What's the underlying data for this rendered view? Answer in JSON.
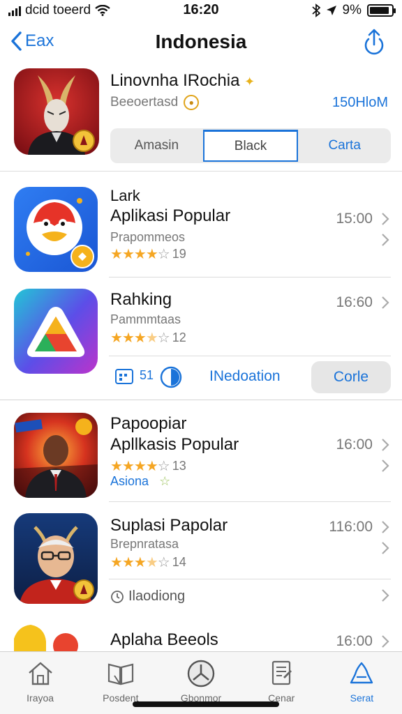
{
  "status_bar": {
    "carrier": "dcid toeerd",
    "time": "16:20",
    "battery_text": "9%",
    "battery_level": 0.9
  },
  "nav": {
    "back_label": "Eax",
    "title": "Indonesia"
  },
  "featured": {
    "title": "Linovnha IRochia",
    "subtitle": "Beeoertasd",
    "price": "150HloM",
    "segments": [
      "Amasin",
      "Black",
      "Carta"
    ],
    "selected_segment": "Black"
  },
  "apps": [
    {
      "line1": "Lark",
      "line2": "Aplikasi Popular",
      "sub": "Prapommeos",
      "rating": 4,
      "rating_count": "19",
      "time": "15:00"
    },
    {
      "line1": "Rahking",
      "sub": "Pammmtaas",
      "rating": 3.5,
      "rating_count": "12",
      "time": "16:60"
    },
    {
      "line1": "Papoopiar",
      "line2": "Apllkasis Popular",
      "rating": 4,
      "rating_count": "13",
      "tag": "Asiona",
      "time": "16:00"
    },
    {
      "line1": "Suplasi Papolar",
      "sub": "Brepnratasa",
      "rating": 3.5,
      "rating_count": "14",
      "time": "116:00"
    },
    {
      "line1": "Aplaha Beeols",
      "time": "16:00"
    }
  ],
  "action_row": {
    "number": "51",
    "link": "INedoation",
    "button": "Corle"
  },
  "list_footer": {
    "label": "Ilaodiong"
  },
  "tabs": [
    {
      "label": "Irayoa",
      "icon": "home-icon"
    },
    {
      "label": "Posdent",
      "icon": "book-icon"
    },
    {
      "label": "Gbonmor",
      "icon": "compass-icon"
    },
    {
      "label": "Cenar",
      "icon": "document-icon"
    },
    {
      "label": "Serat",
      "icon": "search-icon",
      "active": true
    }
  ],
  "colors": {
    "accent": "#1a73d9",
    "star": "#f5a623",
    "separator": "#dcdcdc"
  }
}
